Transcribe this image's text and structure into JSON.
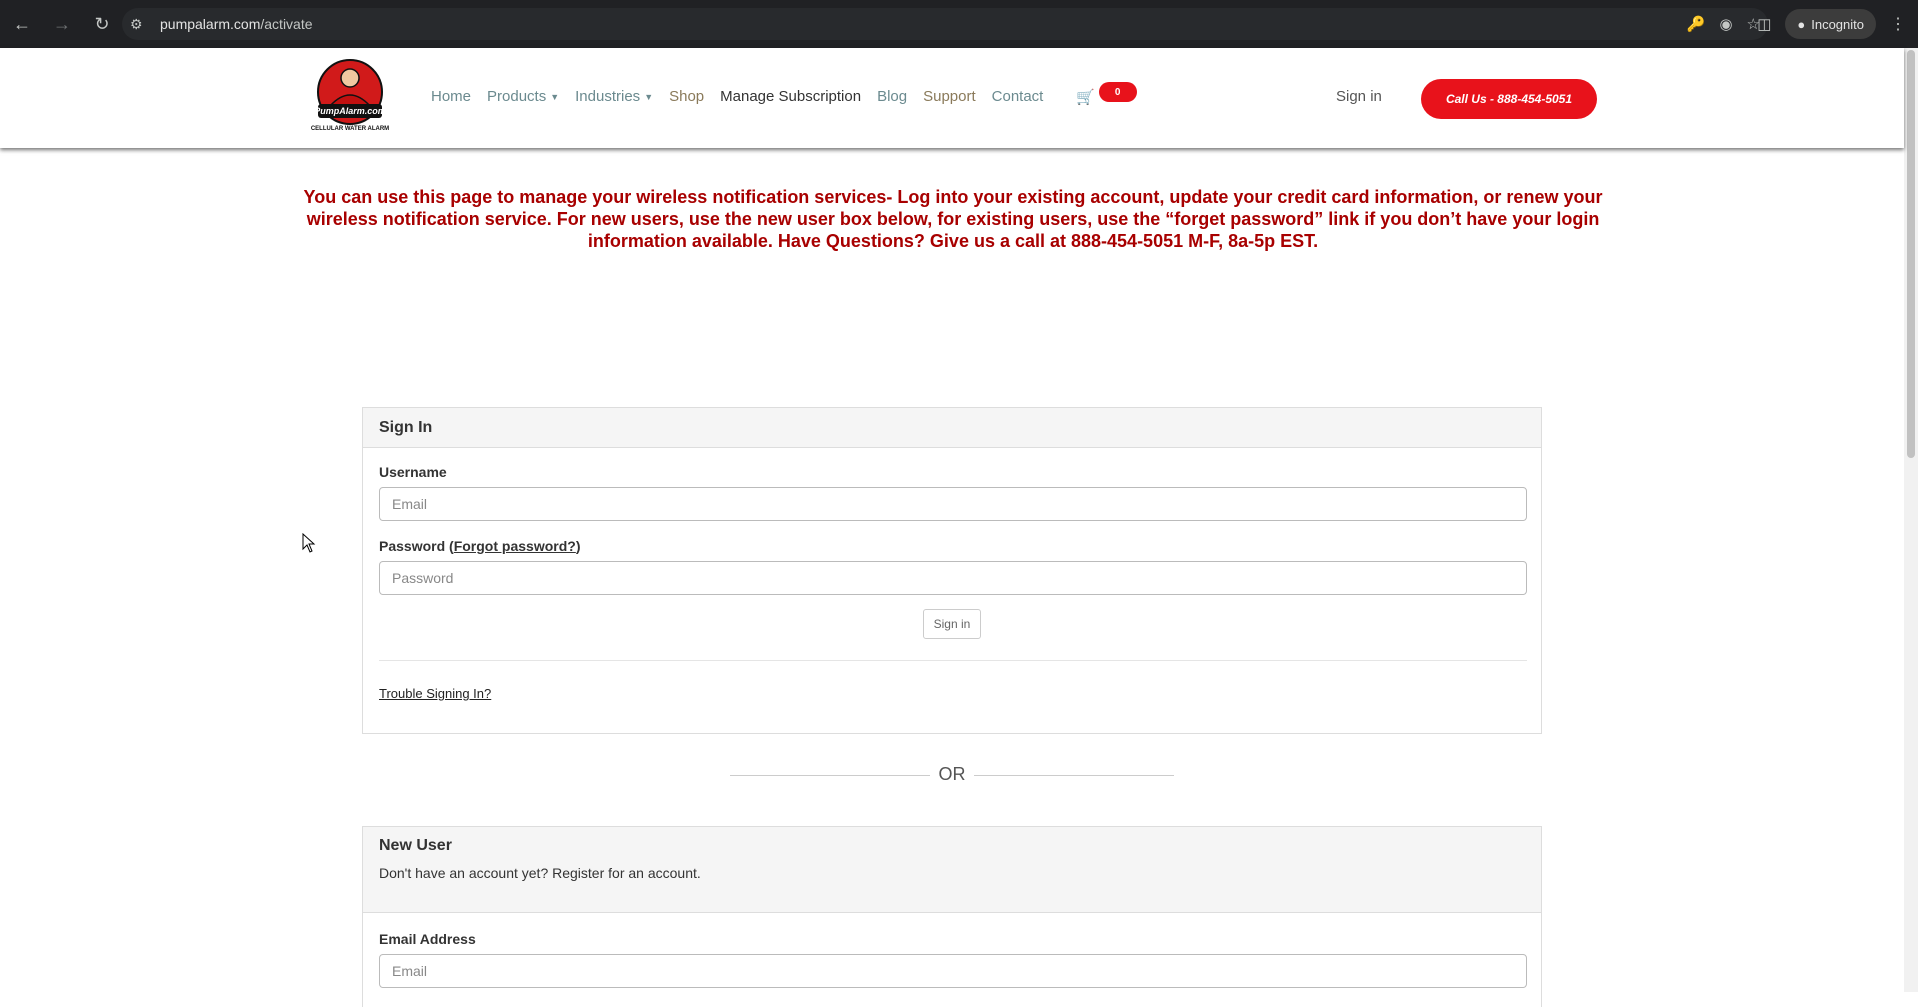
{
  "browser": {
    "url_host": "pumpalarm.com",
    "url_path": "/activate",
    "profile_label": "Incognito"
  },
  "header": {
    "logo": {
      "brand": "PumpAlarm.com",
      "tagline": "CELLULAR WATER ALARM"
    },
    "nav": {
      "home": "Home",
      "products": "Products",
      "industries": "Industries",
      "shop": "Shop",
      "manage_subscription": "Manage Subscription",
      "blog": "Blog",
      "support": "Support",
      "contact": "Contact"
    },
    "cart_count": "0",
    "sign_in": "Sign in",
    "call_button": "Call Us - 888-454-5051"
  },
  "intro": {
    "text": "You can use this page to manage your wireless notification services- Log into your existing account, update your credit card information, or renew your wireless notification service. For new users, use the new user box below, for existing users, use the “forget password” link if you don’t have your login information available. Have Questions? Give us a call at 888-454-5051 M-F, 8a-5p EST."
  },
  "signin_panel": {
    "title": "Sign In",
    "username_label": "Username",
    "username_placeholder": "Email",
    "password_label": "Password",
    "forgot_open": "(",
    "forgot_link": "Forgot password?",
    "forgot_close": ")",
    "password_placeholder": "Password",
    "submit": "Sign in",
    "trouble_link": "Trouble Signing In?"
  },
  "or_text": "OR",
  "new_user_panel": {
    "title": "New User",
    "subtitle": "Don't have an account yet? Register for an account.",
    "email_label": "Email Address",
    "email_placeholder": "Email"
  },
  "colors": {
    "brand_red": "#e8121b",
    "intro_text": "#a80000"
  }
}
